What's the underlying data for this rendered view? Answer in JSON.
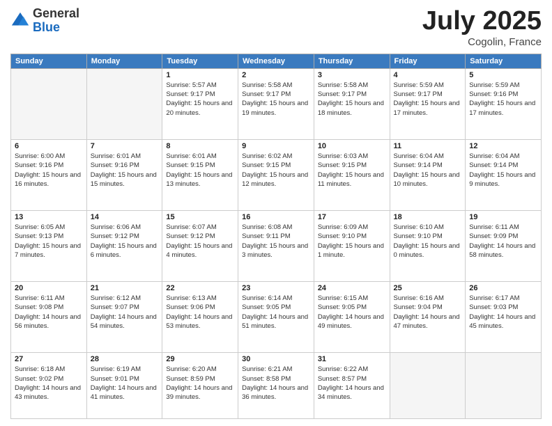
{
  "header": {
    "logo_line1": "General",
    "logo_line2": "Blue",
    "month": "July 2025",
    "location": "Cogolin, France"
  },
  "weekdays": [
    "Sunday",
    "Monday",
    "Tuesday",
    "Wednesday",
    "Thursday",
    "Friday",
    "Saturday"
  ],
  "weeks": [
    [
      {
        "day": "",
        "info": ""
      },
      {
        "day": "",
        "info": ""
      },
      {
        "day": "1",
        "info": "Sunrise: 5:57 AM\nSunset: 9:17 PM\nDaylight: 15 hours and 20 minutes."
      },
      {
        "day": "2",
        "info": "Sunrise: 5:58 AM\nSunset: 9:17 PM\nDaylight: 15 hours and 19 minutes."
      },
      {
        "day": "3",
        "info": "Sunrise: 5:58 AM\nSunset: 9:17 PM\nDaylight: 15 hours and 18 minutes."
      },
      {
        "day": "4",
        "info": "Sunrise: 5:59 AM\nSunset: 9:17 PM\nDaylight: 15 hours and 17 minutes."
      },
      {
        "day": "5",
        "info": "Sunrise: 5:59 AM\nSunset: 9:16 PM\nDaylight: 15 hours and 17 minutes."
      }
    ],
    [
      {
        "day": "6",
        "info": "Sunrise: 6:00 AM\nSunset: 9:16 PM\nDaylight: 15 hours and 16 minutes."
      },
      {
        "day": "7",
        "info": "Sunrise: 6:01 AM\nSunset: 9:16 PM\nDaylight: 15 hours and 15 minutes."
      },
      {
        "day": "8",
        "info": "Sunrise: 6:01 AM\nSunset: 9:15 PM\nDaylight: 15 hours and 13 minutes."
      },
      {
        "day": "9",
        "info": "Sunrise: 6:02 AM\nSunset: 9:15 PM\nDaylight: 15 hours and 12 minutes."
      },
      {
        "day": "10",
        "info": "Sunrise: 6:03 AM\nSunset: 9:15 PM\nDaylight: 15 hours and 11 minutes."
      },
      {
        "day": "11",
        "info": "Sunrise: 6:04 AM\nSunset: 9:14 PM\nDaylight: 15 hours and 10 minutes."
      },
      {
        "day": "12",
        "info": "Sunrise: 6:04 AM\nSunset: 9:14 PM\nDaylight: 15 hours and 9 minutes."
      }
    ],
    [
      {
        "day": "13",
        "info": "Sunrise: 6:05 AM\nSunset: 9:13 PM\nDaylight: 15 hours and 7 minutes."
      },
      {
        "day": "14",
        "info": "Sunrise: 6:06 AM\nSunset: 9:12 PM\nDaylight: 15 hours and 6 minutes."
      },
      {
        "day": "15",
        "info": "Sunrise: 6:07 AM\nSunset: 9:12 PM\nDaylight: 15 hours and 4 minutes."
      },
      {
        "day": "16",
        "info": "Sunrise: 6:08 AM\nSunset: 9:11 PM\nDaylight: 15 hours and 3 minutes."
      },
      {
        "day": "17",
        "info": "Sunrise: 6:09 AM\nSunset: 9:10 PM\nDaylight: 15 hours and 1 minute."
      },
      {
        "day": "18",
        "info": "Sunrise: 6:10 AM\nSunset: 9:10 PM\nDaylight: 15 hours and 0 minutes."
      },
      {
        "day": "19",
        "info": "Sunrise: 6:11 AM\nSunset: 9:09 PM\nDaylight: 14 hours and 58 minutes."
      }
    ],
    [
      {
        "day": "20",
        "info": "Sunrise: 6:11 AM\nSunset: 9:08 PM\nDaylight: 14 hours and 56 minutes."
      },
      {
        "day": "21",
        "info": "Sunrise: 6:12 AM\nSunset: 9:07 PM\nDaylight: 14 hours and 54 minutes."
      },
      {
        "day": "22",
        "info": "Sunrise: 6:13 AM\nSunset: 9:06 PM\nDaylight: 14 hours and 53 minutes."
      },
      {
        "day": "23",
        "info": "Sunrise: 6:14 AM\nSunset: 9:05 PM\nDaylight: 14 hours and 51 minutes."
      },
      {
        "day": "24",
        "info": "Sunrise: 6:15 AM\nSunset: 9:05 PM\nDaylight: 14 hours and 49 minutes."
      },
      {
        "day": "25",
        "info": "Sunrise: 6:16 AM\nSunset: 9:04 PM\nDaylight: 14 hours and 47 minutes."
      },
      {
        "day": "26",
        "info": "Sunrise: 6:17 AM\nSunset: 9:03 PM\nDaylight: 14 hours and 45 minutes."
      }
    ],
    [
      {
        "day": "27",
        "info": "Sunrise: 6:18 AM\nSunset: 9:02 PM\nDaylight: 14 hours and 43 minutes."
      },
      {
        "day": "28",
        "info": "Sunrise: 6:19 AM\nSunset: 9:01 PM\nDaylight: 14 hours and 41 minutes."
      },
      {
        "day": "29",
        "info": "Sunrise: 6:20 AM\nSunset: 8:59 PM\nDaylight: 14 hours and 39 minutes."
      },
      {
        "day": "30",
        "info": "Sunrise: 6:21 AM\nSunset: 8:58 PM\nDaylight: 14 hours and 36 minutes."
      },
      {
        "day": "31",
        "info": "Sunrise: 6:22 AM\nSunset: 8:57 PM\nDaylight: 14 hours and 34 minutes."
      },
      {
        "day": "",
        "info": ""
      },
      {
        "day": "",
        "info": ""
      }
    ]
  ]
}
